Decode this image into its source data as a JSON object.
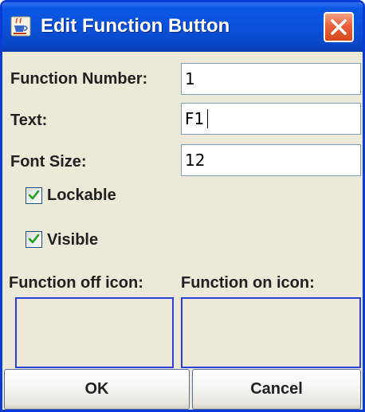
{
  "window": {
    "title": "Edit Function Button",
    "app_icon": "java-cup-icon",
    "close_icon": "close-icon"
  },
  "form": {
    "function_number": {
      "label": "Function Number:",
      "value": "1"
    },
    "text": {
      "label": "Text:",
      "value": "F1"
    },
    "font_size": {
      "label": "Font Size:",
      "value": "12"
    },
    "lockable": {
      "label": "Lockable",
      "checked": true
    },
    "visible": {
      "label": "Visible",
      "checked": true
    },
    "function_off_icon": {
      "label": "Function off icon:"
    },
    "function_on_icon": {
      "label": "Function on icon:"
    }
  },
  "buttons": {
    "ok_label": "OK",
    "cancel_label": "Cancel"
  },
  "colors": {
    "titlebar": "#0a50d8",
    "close_button": "#e8623b",
    "dialog_background": "#ece9d8",
    "icon_well_border": "#2c3fd6"
  }
}
